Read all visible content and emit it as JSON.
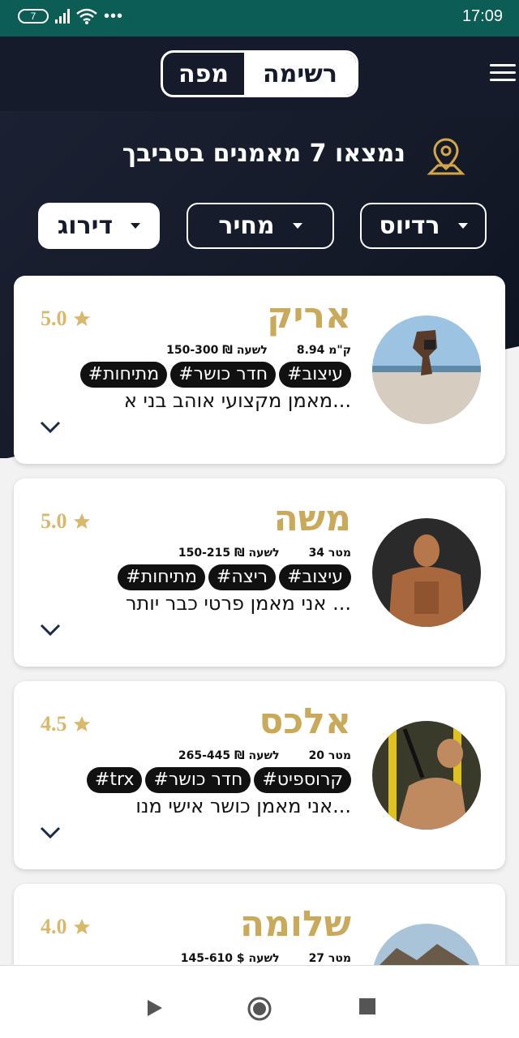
{
  "status_bar": {
    "battery": "7",
    "time": "17:09",
    "more": "•••"
  },
  "header": {
    "tab_map": "מפה",
    "tab_list": "רשימה",
    "active_tab": "רשימה"
  },
  "summary": {
    "found_text": "נמצאו 7 מאמנים בסביבך"
  },
  "filters": {
    "radius": "רדיוס",
    "price": "מחיר",
    "rating": "דירוג",
    "active": "דירוג"
  },
  "colors": {
    "header_bg": "#151b2b",
    "accent_gold": "#c9a95a",
    "status_bar": "#0b5d55"
  },
  "trainers": [
    {
      "name": "אריק",
      "rating": "5.0",
      "distance": "8.94 ק\"מ",
      "price": "150-300 ₪ לשעה",
      "tags": [
        "#עיצוב",
        "#חדר כושר",
        "#מתיחות"
      ],
      "description": "מאמן מקצועי אוהב בני א..."
    },
    {
      "name": "משה",
      "rating": "5.0",
      "distance": "34 מטר",
      "price": "150-215 ₪ לשעה",
      "tags": [
        "#עיצוב",
        "#ריצה",
        "#מתיחות"
      ],
      "description": "אני מאמן פרטי כבר יותר ..."
    },
    {
      "name": "אלכס",
      "rating": "4.5",
      "distance": "20 מטר",
      "price": "265-445 ₪ לשעה",
      "tags": [
        "#קרוספיט",
        "#חדר כושר",
        "#trx"
      ],
      "description": "אני מאמן כושר אישי מנו..."
    },
    {
      "name": "שלומה",
      "rating": "4.0",
      "distance": "27 מטר",
      "price": "145-610 $ לשעה",
      "tags": [],
      "description": ""
    }
  ],
  "icons": {
    "pin": "location-pin-icon",
    "star": "star-icon",
    "chevron": "chevron-down-icon",
    "menu": "hamburger-menu-icon"
  }
}
